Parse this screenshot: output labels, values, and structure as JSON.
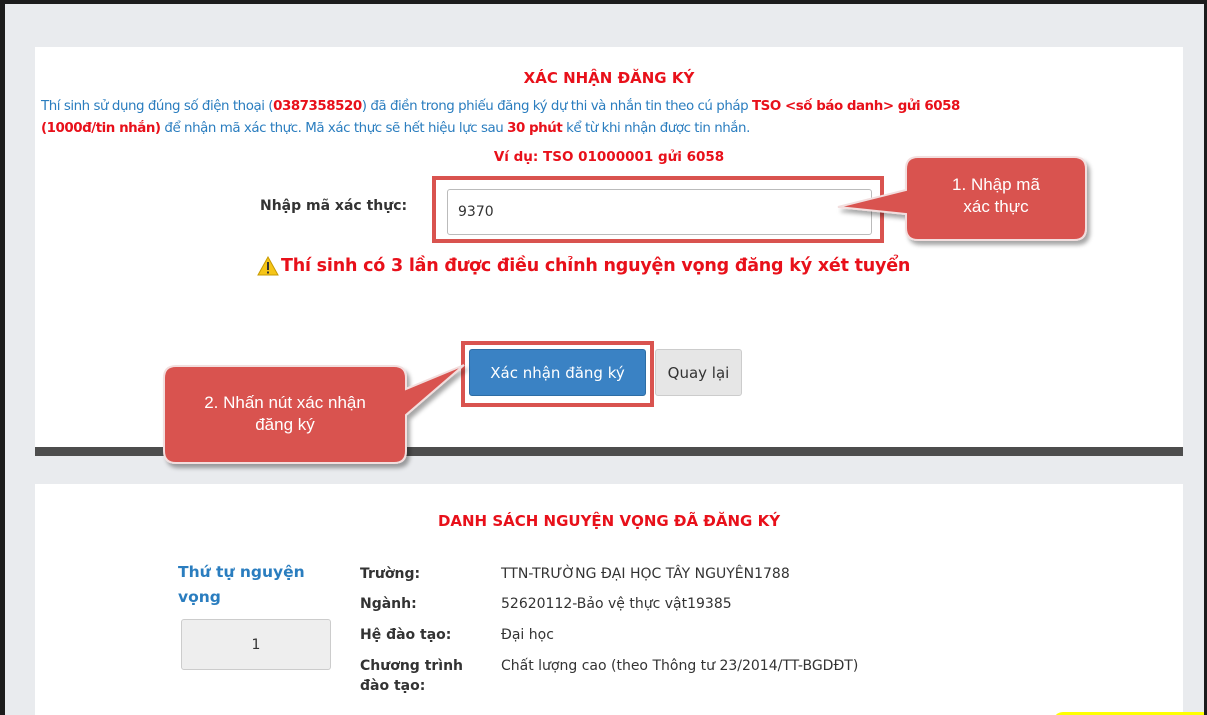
{
  "confirm": {
    "title": "XÁC NHẬN ĐĂNG KÝ",
    "desc_1": "Thí sinh sử dụng đúng số điện thoại (",
    "phone": "0387358520",
    "desc_2": ") đã điền trong phiếu đăng ký dự thi và nhắn tin theo cú pháp ",
    "syntax": "TSO <số báo danh> gửi 6058",
    "fee": "(1000đ/tin nhắn)",
    "desc_3": " để nhận mã xác thực. Mã xác thực sẽ hết hiệu lực sau ",
    "expiry": "30 phút",
    "desc_4": " kể từ khi nhận được tin nhắn.",
    "example": "Ví dụ: TSO 01000001 gửi 6058",
    "otp_label": "Nhập mã xác thực:",
    "otp_value": "9370",
    "warning": "Thí sinh có 3 lần được điều chỉnh nguyện vọng đăng ký xét tuyển",
    "confirm_button": "Xác nhận đăng ký",
    "back_button": "Quay lại"
  },
  "callouts": {
    "step1": "1. Nhập mã xác thực",
    "step1_line1": "1. Nhập mã",
    "step1_line2": "xác thực",
    "step2": "2. Nhấn nút xác nhận đăng ký",
    "step2_line1": "2. Nhấn nút xác nhận",
    "step2_line2": "đăng ký"
  },
  "list": {
    "title": "DANH SÁCH NGUYỆN VỌNG ĐÃ ĐĂNG KÝ",
    "order_label": "Thứ tự nguyện vọng",
    "order_value": "1",
    "fields": [
      {
        "key": "Trường:",
        "value": "TTN-TRƯỜNG ĐẠI HỌC TÂY NGUYÊN1788"
      },
      {
        "key": "Ngành:",
        "value": "52620112-Bảo vệ thực vật19385"
      },
      {
        "key": "Hệ đào tạo:",
        "value": "Đại học"
      },
      {
        "key": "Chương trình đào tạo:",
        "value": "Chất lượng cao (theo Thông tư 23/2014/TT-BGDĐT)"
      }
    ]
  },
  "colors": {
    "accent_red": "#e8101a",
    "link_blue": "#2a7dbf",
    "callout_red": "#d9534f",
    "primary_button": "#3a82c4"
  },
  "icons": {
    "warning": "warning-triangle-icon"
  }
}
